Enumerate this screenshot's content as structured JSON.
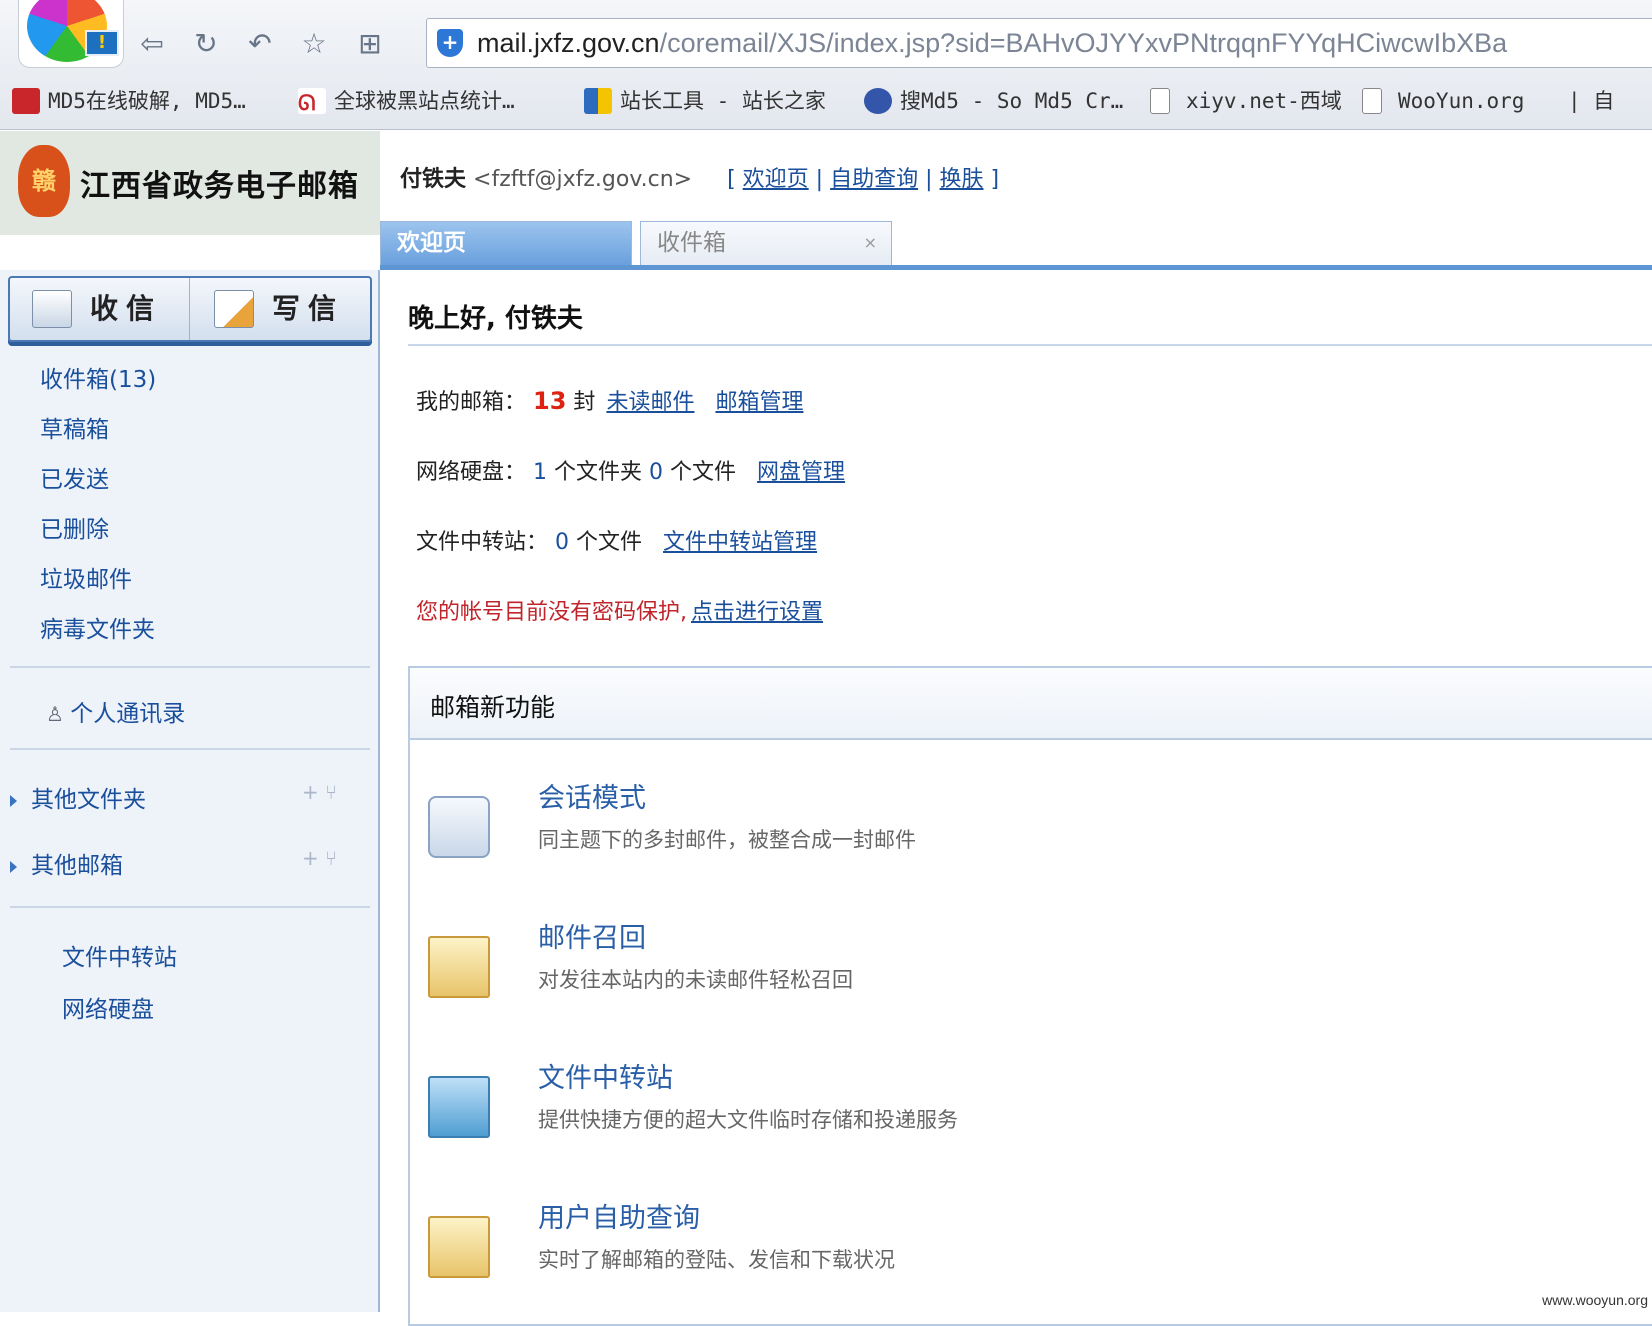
{
  "browser": {
    "url_prefix": "mail.jxfz.gov.cn",
    "url_rest": "/coremail/XJS/index.jsp?sid=BAHvOJYYxvPNtrqqnFYYqHCiwcwIbXBa",
    "bookmarks": [
      {
        "label": "MD5在线破解, MD5…",
        "icon": "md5-icon",
        "color": "#c8262b"
      },
      {
        "label": "全球被黑站点统计…",
        "icon": "dragon-icon",
        "color": "#c8262b"
      },
      {
        "label": "站长工具 - 站长之家",
        "icon": "chart-icon",
        "color": "#2d6bbf"
      },
      {
        "label": "搜Md5 - So Md5 Cr…",
        "icon": "news-icon",
        "color": "#3355aa"
      },
      {
        "label": "xiyv.net-西域",
        "icon": "page-icon",
        "color": "#ffffff"
      },
      {
        "label": "WooYun.org",
        "icon": "page-icon",
        "color": "#ffffff"
      },
      {
        "label": "| 自",
        "icon": "",
        "color": ""
      }
    ]
  },
  "brand": {
    "name": "江西省政务电子邮箱",
    "emblem": "赣"
  },
  "user": {
    "name": "付铁夫",
    "email": "<fzftf@jxfz.gov.cn>",
    "link_welcome": "欢迎页",
    "link_query": "自助查询",
    "link_skin": "换肤"
  },
  "tabs": [
    {
      "label": "欢迎页"
    },
    {
      "label": "收件箱",
      "close": "×"
    }
  ],
  "sidebar": {
    "receive": "收信",
    "write": "写信",
    "folders": [
      "收件箱(13)",
      "草稿箱",
      "已发送",
      "已删除",
      "垃圾邮件",
      "病毒文件夹"
    ],
    "contacts": "个人通讯录",
    "groups": [
      "其他文件夹",
      "其他邮箱"
    ],
    "group_actions": "+ ⑂",
    "tools": [
      "文件中转站",
      "网络硬盘"
    ]
  },
  "main": {
    "greeting": "晚上好, 付铁夫",
    "mailbox_label": "我的邮箱：",
    "mailbox_count": "13",
    "mailbox_unit": "封",
    "mailbox_unread_link": "未读邮件",
    "mailbox_manage_link": "邮箱管理",
    "disk_label": "网络硬盘：",
    "disk_folders": "1",
    "disk_folders_unit": "个文件夹",
    "disk_files": "0",
    "disk_files_unit": "个文件",
    "disk_manage_link": "网盘管理",
    "transfer_label": "文件中转站：",
    "transfer_files": "0",
    "transfer_unit": "个文件",
    "transfer_manage_link": "文件中转站管理",
    "warning_text": "您的帐号目前没有密码保护,",
    "warning_link": "点击进行设置",
    "new_features_title": "邮箱新功能",
    "features": [
      {
        "title": "会话模式",
        "desc": "同主题下的多封邮件，被整合成一封邮件",
        "icon": "chat-bubbles-icon"
      },
      {
        "title": "邮件召回",
        "desc": "对发往本站内的未读邮件轻松召回",
        "icon": "mail-recall-icon"
      },
      {
        "title": "文件中转站",
        "desc": "提供快捷方便的超大文件临时存储和投递服务",
        "icon": "folder-transfer-icon"
      },
      {
        "title": "用户自助查询",
        "desc": "实时了解邮箱的登陆、发信和下载状况",
        "icon": "mail-search-icon"
      }
    ]
  },
  "watermark": "www.wooyun.org"
}
